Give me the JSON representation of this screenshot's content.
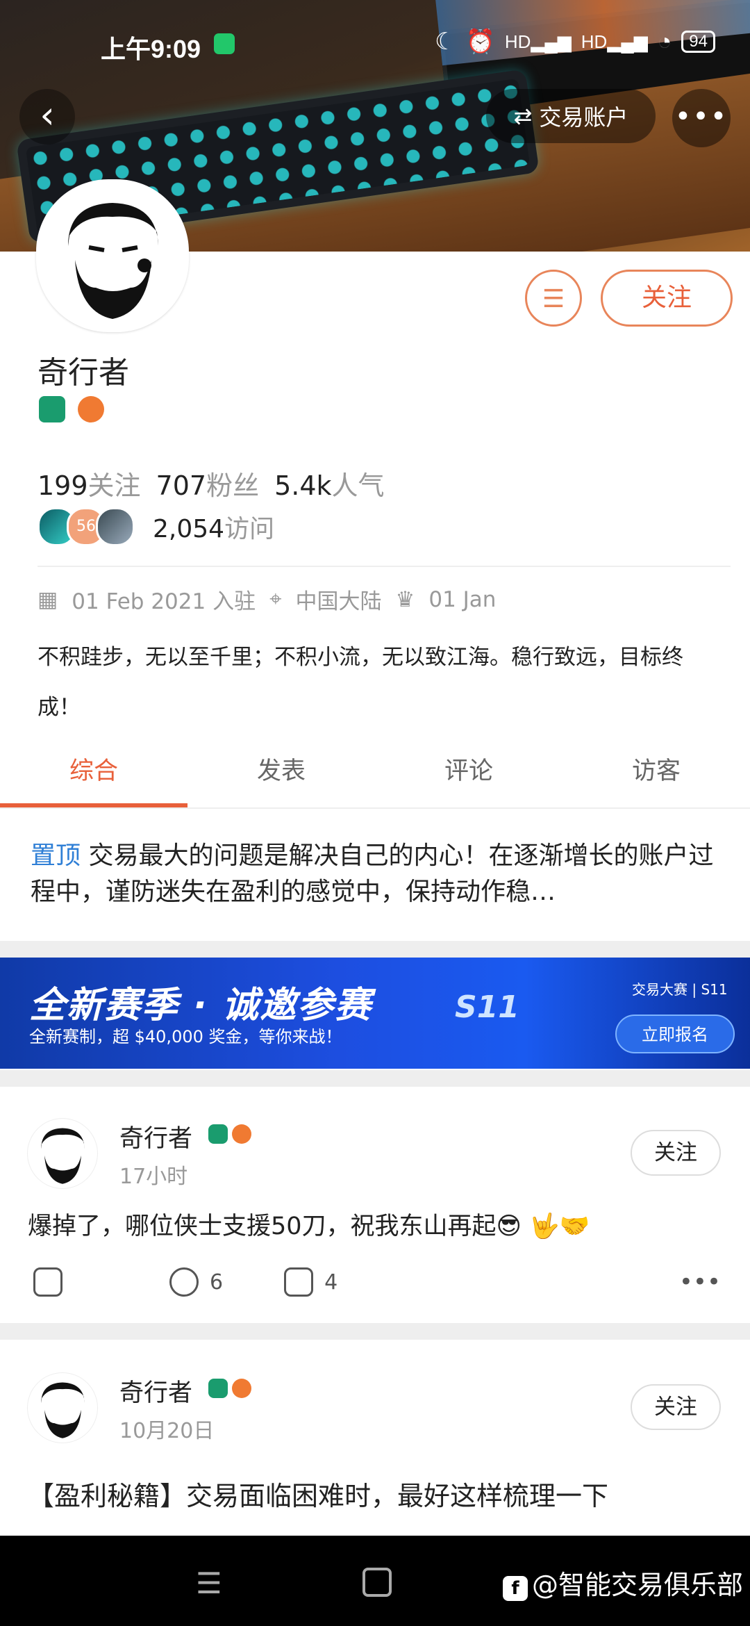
{
  "status_bar": {
    "time": "上午9:09",
    "battery": "94"
  },
  "header": {
    "account_button": "交易账户"
  },
  "profile": {
    "name": "奇行者",
    "follow_label": "关注",
    "stats": [
      {
        "value": "199",
        "label": "关注"
      },
      {
        "value": "707",
        "label": "粉丝"
      },
      {
        "value": "5.4k",
        "label": "人气"
      }
    ],
    "visitor_badge": "56",
    "visits_value": "2,054",
    "visits_label": "访问",
    "joined": "01 Feb 2021 入驻",
    "location": "中国大陆",
    "birthday": "01 Jan",
    "bio": "不积跬步，无以至千里；不积小流，无以致江海。稳行致远，目标终成！"
  },
  "tabs": [
    "综合",
    "发表",
    "评论",
    "访客"
  ],
  "pinned": {
    "tag": "置顶",
    "text": "交易最大的问题是解决自己的内心！在逐渐增长的账户过程中，谨防迷失在盈利的感觉中，保持动作稳…"
  },
  "ad": {
    "title": "全新赛季 · 诚邀参赛",
    "subtitle": "全新赛制，超 $40,000 奖金，等你来战！",
    "brand": "交易大赛 | S11",
    "season": "S11",
    "button": "立即报名"
  },
  "posts": [
    {
      "author": "奇行者",
      "time": "17小时",
      "follow": "关注",
      "content": "爆掉了，哪位侠士支援50刀，祝我东山再起😎 🤟🤝",
      "comments": "6",
      "likes": "4"
    },
    {
      "author": "奇行者",
      "time": "10月20日",
      "follow": "关注",
      "title": "【盈利秘籍】交易面临困难时，最好这样梳理一下"
    }
  ],
  "watermark": "@智能交易俱乐部",
  "colors": {
    "accent": "#e8603a",
    "link": "#2f7fd6",
    "ad_blue": "#1d4ee0"
  }
}
